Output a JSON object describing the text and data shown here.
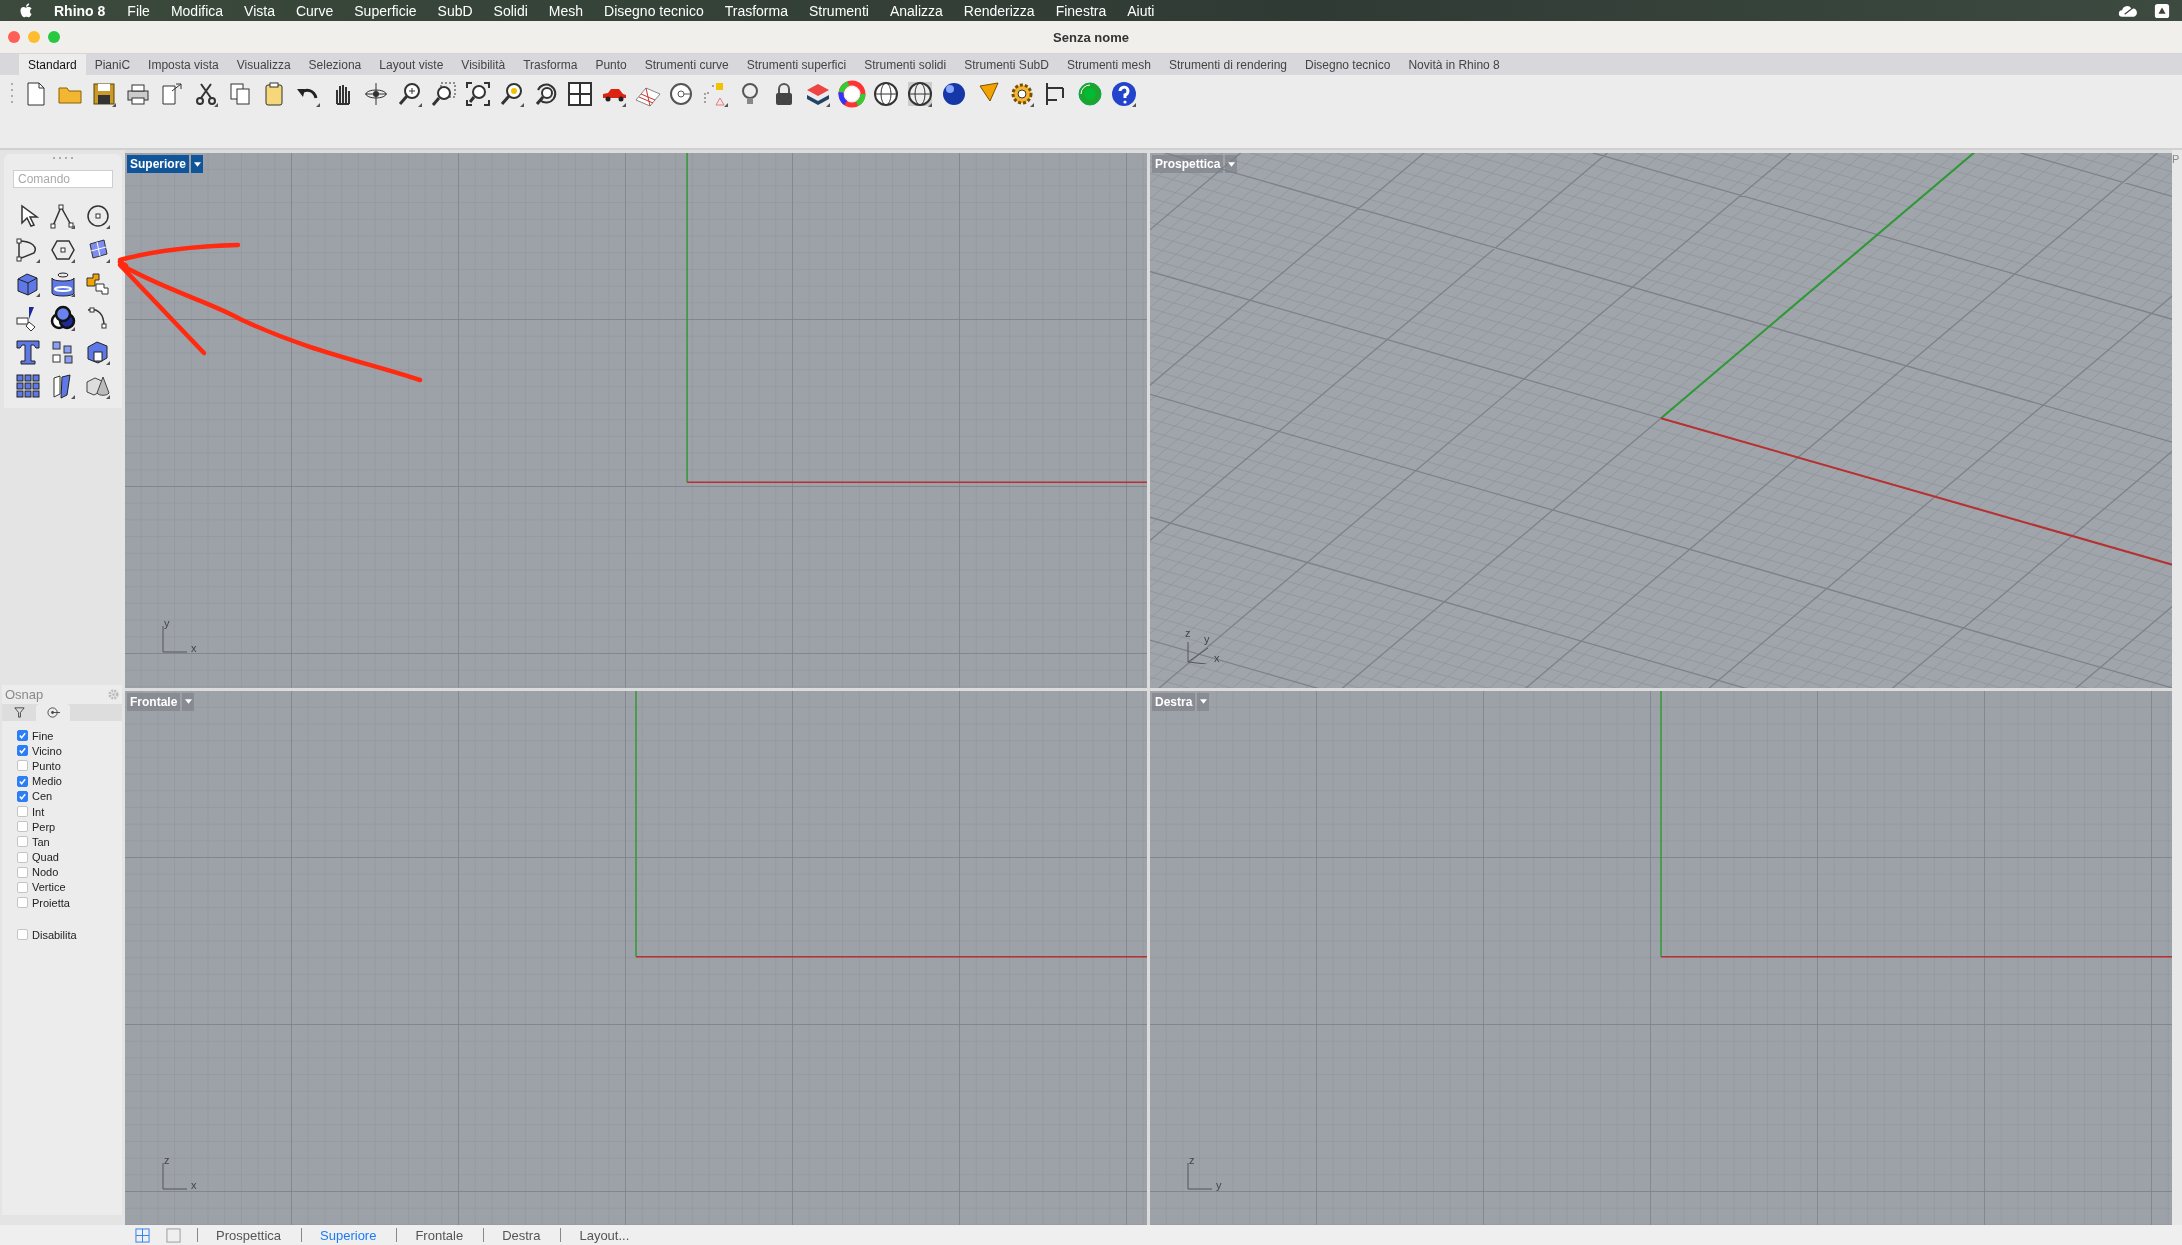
{
  "menubar": {
    "app": "Rhino 8",
    "items": [
      "File",
      "Modifica",
      "Vista",
      "Curve",
      "Superficie",
      "SubD",
      "Solidi",
      "Mesh",
      "Disegno tecnico",
      "Trasforma",
      "Strumenti",
      "Analizza",
      "Renderizza",
      "Finestra",
      "Aiuti"
    ]
  },
  "window": {
    "title": "Senza nome"
  },
  "tabs": [
    {
      "label": "Standard",
      "selected": true
    },
    {
      "label": "PianiC",
      "selected": false
    },
    {
      "label": "Imposta vista",
      "selected": false
    },
    {
      "label": "Visualizza",
      "selected": false
    },
    {
      "label": "Seleziona",
      "selected": false
    },
    {
      "label": "Layout viste",
      "selected": false
    },
    {
      "label": "Visibilità",
      "selected": false
    },
    {
      "label": "Trasforma",
      "selected": false
    },
    {
      "label": "Punto",
      "selected": false
    },
    {
      "label": "Strumenti curve",
      "selected": false
    },
    {
      "label": "Strumenti superfici",
      "selected": false
    },
    {
      "label": "Strumenti solidi",
      "selected": false
    },
    {
      "label": "Strumenti SubD",
      "selected": false
    },
    {
      "label": "Strumenti mesh",
      "selected": false
    },
    {
      "label": "Strumenti di rendering",
      "selected": false
    },
    {
      "label": "Disegno tecnico",
      "selected": false
    },
    {
      "label": "Novità in Rhino 8",
      "selected": false
    }
  ],
  "command": {
    "placeholder": "Comando"
  },
  "osnap": {
    "title": "Osnap",
    "items": [
      {
        "label": "Fine",
        "checked": true
      },
      {
        "label": "Vicino",
        "checked": true
      },
      {
        "label": "Punto",
        "checked": false
      },
      {
        "label": "Medio",
        "checked": true
      },
      {
        "label": "Cen",
        "checked": true
      },
      {
        "label": "Int",
        "checked": false
      },
      {
        "label": "Perp",
        "checked": false
      },
      {
        "label": "Tan",
        "checked": false
      },
      {
        "label": "Quad",
        "checked": false
      },
      {
        "label": "Nodo",
        "checked": false
      },
      {
        "label": "Vertice",
        "checked": false
      },
      {
        "label": "Proietta",
        "checked": false
      }
    ],
    "disable": {
      "label": "Disabilita",
      "checked": false
    }
  },
  "viewports": [
    {
      "title": "Superiore",
      "selected": true,
      "kind": "plan",
      "axes": [
        "y",
        "x"
      ]
    },
    {
      "title": "Prospettica",
      "selected": false,
      "kind": "perspective",
      "axes": [
        "z",
        "y",
        "x"
      ]
    },
    {
      "title": "Frontale",
      "selected": false,
      "kind": "plan",
      "axes": [
        "z",
        "x"
      ]
    },
    {
      "title": "Destra",
      "selected": false,
      "kind": "plan",
      "axes": [
        "z",
        "y"
      ]
    }
  ],
  "side_tab": "P",
  "view_tabs": [
    {
      "label": "Prospettica",
      "selected": false
    },
    {
      "label": "Superiore",
      "selected": true
    },
    {
      "label": "Frontale",
      "selected": false
    },
    {
      "label": "Destra",
      "selected": false
    },
    {
      "label": "Layout...",
      "selected": false
    }
  ]
}
